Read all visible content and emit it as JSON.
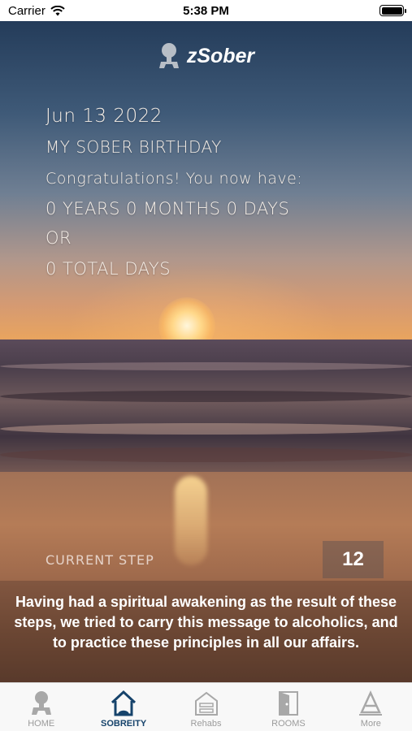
{
  "status_bar": {
    "carrier": "Carrier",
    "time": "5:38 PM"
  },
  "header": {
    "app_name": "zSober"
  },
  "sobriety": {
    "date": "Jun 13 2022",
    "heading": "MY SOBER BIRTHDAY",
    "congrats": "Congratulations! You now have:",
    "duration": "0 YEARS 0 MONTHS 0 DAYS",
    "or_label": "OR",
    "total_days": "0 TOTAL DAYS"
  },
  "step": {
    "label": "CURRENT STEP",
    "number": "12",
    "text": "Having had a spiritual awakening as the result of these steps, we tried to carry this message to alcoholics, and to practice these principles in all our affairs."
  },
  "tabs": [
    {
      "label": "HOME",
      "icon": "person-icon"
    },
    {
      "label": "SOBREITY",
      "icon": "house-icon",
      "active": true
    },
    {
      "label": "Rehabs",
      "icon": "building-icon"
    },
    {
      "label": "ROOMS",
      "icon": "door-icon"
    },
    {
      "label": "More",
      "icon": "more-icon"
    }
  ],
  "colors": {
    "active_tab": "#16436b",
    "inactive_tab": "#9b9b9b"
  }
}
